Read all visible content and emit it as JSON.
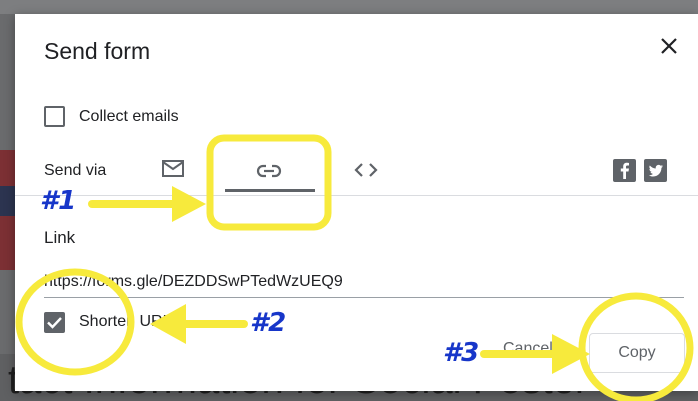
{
  "background": {
    "heading_text": "tact Information for Social Poster"
  },
  "dialog": {
    "title": "Send form",
    "close_icon": "close-icon",
    "collect_emails": {
      "label": "Collect emails",
      "checked": false
    },
    "send_via": {
      "label": "Send via",
      "tabs": [
        {
          "icon": "email-icon",
          "active": false
        },
        {
          "icon": "link-icon",
          "active": true
        },
        {
          "icon": "embed-icon",
          "active": false
        }
      ],
      "social": [
        "facebook-icon",
        "twitter-icon"
      ]
    },
    "link_section": {
      "heading": "Link",
      "url": "https://forms.gle/DEZDDSwPTedWzUEQ9"
    },
    "shorten_url": {
      "label": "Shorten URL",
      "checked": true
    },
    "buttons": {
      "cancel": "Cancel",
      "copy": "Copy"
    }
  },
  "annotations": {
    "marker1": "#1",
    "marker2": "#2",
    "marker3": "#3",
    "highlight_color": "#f7ea3c",
    "marker_color": "#1736c9"
  },
  "colors": {
    "icon_gray": "#5f6368",
    "text": "#202124",
    "divider": "#dadce0"
  }
}
